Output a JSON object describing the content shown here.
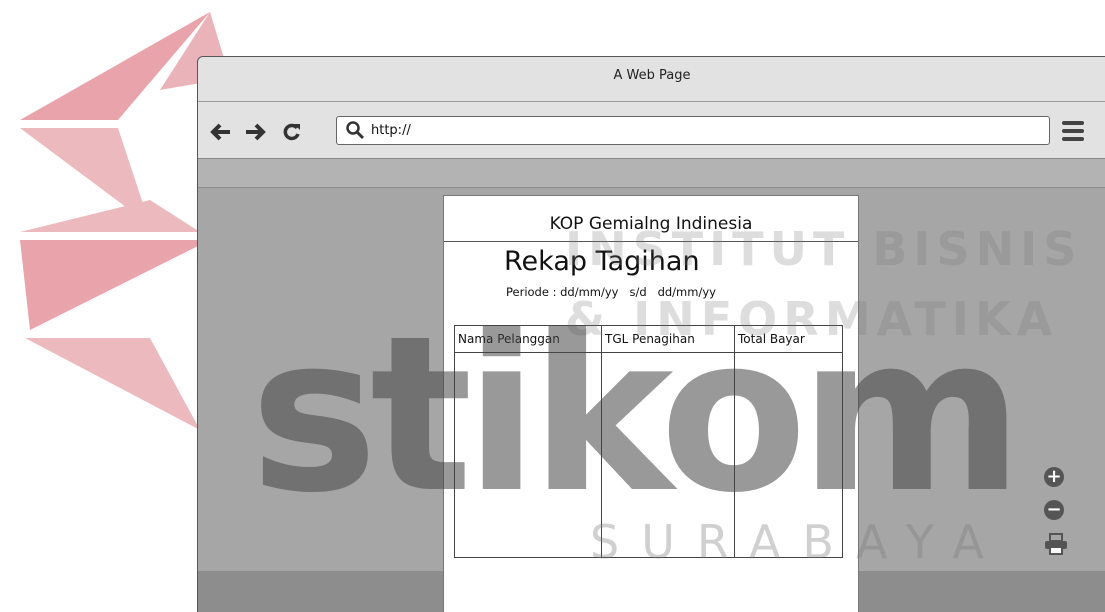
{
  "window": {
    "title": "A Web Page"
  },
  "toolbar": {
    "back_icon": "arrow-left-icon",
    "forward_icon": "arrow-right-icon",
    "reload_icon": "reload-icon",
    "url_value": "http://",
    "menu_icon": "hamburger-menu-icon"
  },
  "report": {
    "kop": "KOP Gemialng Indinesia",
    "title": "Rekap Tagihan",
    "periode": "Periode : dd/mm/yy   s/d   dd/mm/yy",
    "columns": [
      "Nama Pelanggan",
      "TGL Penagihan",
      "Total Bayar"
    ]
  },
  "side_controls": {
    "zoom_in_icon": "zoom-in-icon",
    "zoom_out_icon": "zoom-out-icon",
    "print_icon": "print-icon"
  },
  "watermark": {
    "line1": "INSTITUT BISNIS",
    "line2": "& INFORMATIKA",
    "logo": "stikom",
    "city": "SURABAYA",
    "colors": {
      "red": "#e8a3ab",
      "dark": "#555555",
      "lightgray": "#e6e6e6"
    }
  }
}
